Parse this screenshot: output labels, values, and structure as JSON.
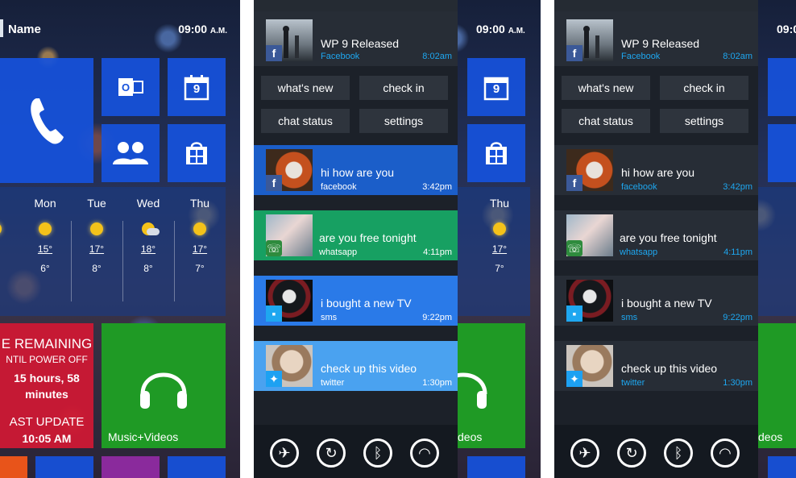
{
  "start": {
    "name": "Name",
    "time": "09:00",
    "ampm": "A.M.",
    "weather": [
      {
        "day": "Mon",
        "hi": "15°",
        "lo": "6°",
        "cond": "sun"
      },
      {
        "day": "Tue",
        "hi": "17°",
        "lo": "8°",
        "cond": "sun"
      },
      {
        "day": "Wed",
        "hi": "18°",
        "lo": "8°",
        "cond": "cloudy"
      },
      {
        "day": "Thu",
        "hi": "17°",
        "lo": "7°",
        "cond": "sun"
      }
    ],
    "battery": {
      "line1": "E REMAINING",
      "line2": "NTIL POWER OFF",
      "line3": "15 hours, 58",
      "line4": "minutes",
      "line5": "AST UPDATE",
      "line6": "10:05 AM"
    },
    "music_label": "Music+Videos",
    "calendar_day": "9"
  },
  "action_center": {
    "time": "09:00",
    "ampm": "A.M.",
    "head": {
      "title": "WP 9 Released",
      "source": "Facebook",
      "time": "8:02am"
    },
    "quick": [
      "what's new",
      "check in",
      "chat status",
      "settings"
    ],
    "notifications": [
      {
        "title": "hi how are you",
        "source": "facebook",
        "time": "3:42pm",
        "color": "#1b5ec9",
        "badge": "facebook"
      },
      {
        "title": "are you free tonight",
        "source": "whatsapp",
        "time": "4:11pm",
        "color": "#17a062",
        "badge": "whatsapp"
      },
      {
        "title": "i bought a new TV",
        "source": "sms",
        "time": "9:22pm",
        "color": "#2a7ae8",
        "badge": "sms"
      },
      {
        "title": "check up this video",
        "source": "twitter",
        "time": "1:30pm",
        "color": "#4aa2f0",
        "badge": "twitter"
      }
    ],
    "side_labels": {
      "thu": "Thu",
      "hi": "17°",
      "lo": "7°",
      "music": "deos"
    }
  },
  "colors": {
    "accent_blue": "#1652dc",
    "panel": "#1c2129",
    "source_blue": "#1ea7f0"
  }
}
